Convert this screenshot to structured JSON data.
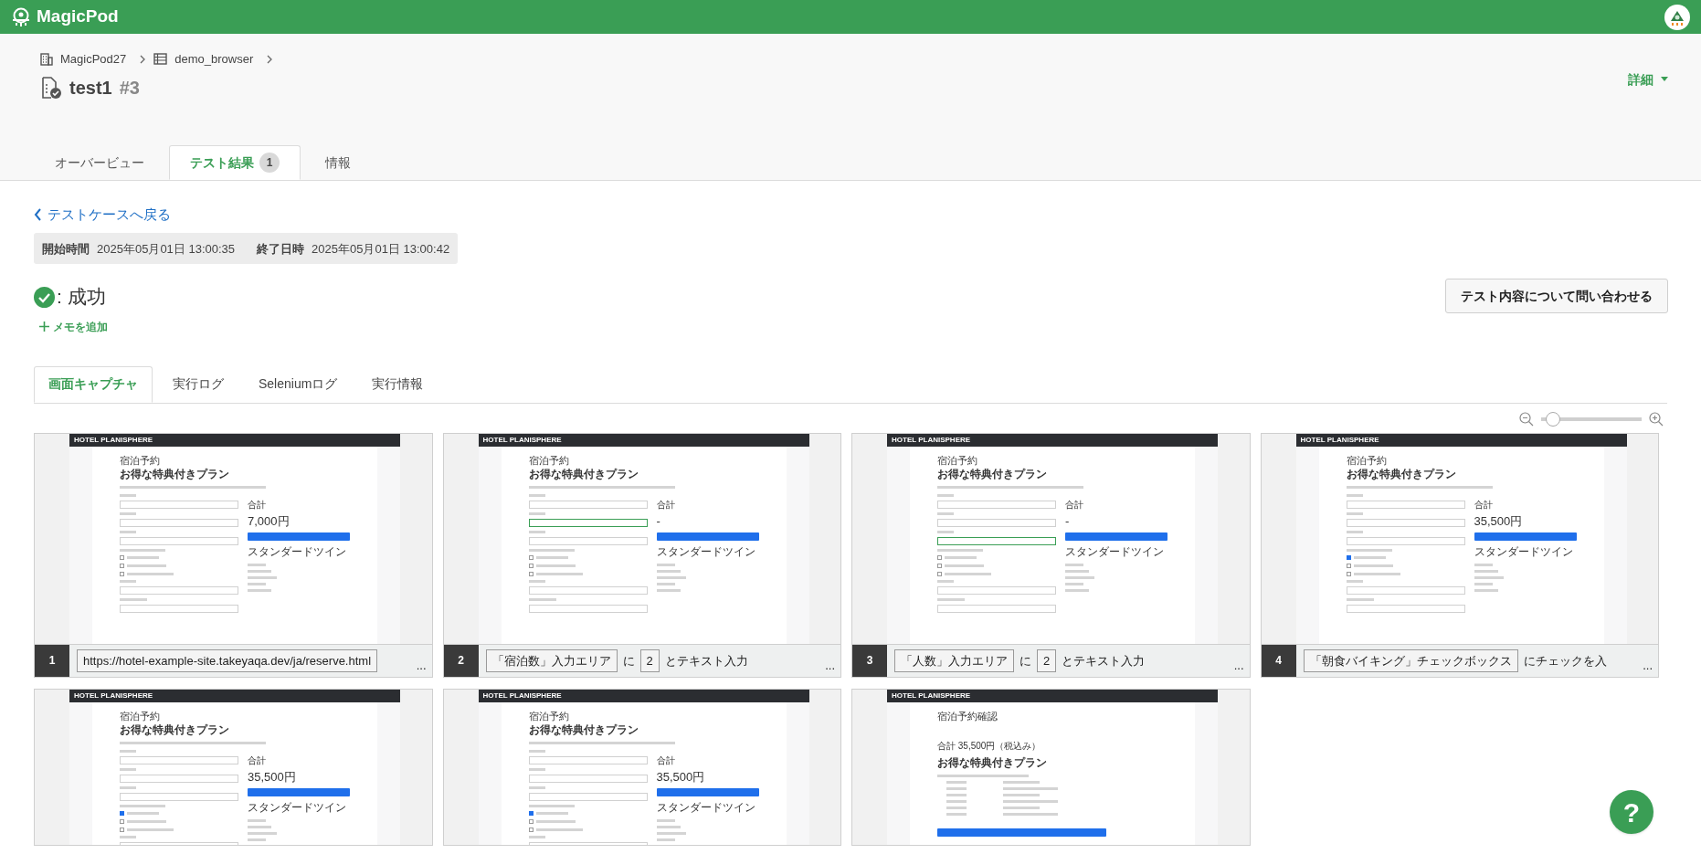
{
  "app": {
    "brand": "MagicPod"
  },
  "breadcrumb": [
    {
      "kind": "org",
      "label": "MagicPod27"
    },
    {
      "kind": "project",
      "label": "demo_browser"
    }
  ],
  "title": {
    "name": "test1",
    "number": "#3"
  },
  "details_menu": {
    "label": "詳細"
  },
  "tabs": [
    {
      "label": "オーバービュー",
      "selected": false
    },
    {
      "label": "テスト結果",
      "badge": "1",
      "selected": true
    },
    {
      "label": "情報",
      "selected": false
    }
  ],
  "back_link": "テストケースへ戻る",
  "times": [
    {
      "label": "開始時間",
      "value": "2025年05月01日 13:00:35"
    },
    {
      "label": "終了日時",
      "value": "2025年05月01日 13:00:42"
    }
  ],
  "result": {
    "kind": "success",
    "label": ": 成功"
  },
  "add_memo": "メモを追加",
  "contact_button": "テスト内容について問い合わせる",
  "sub_tabs": [
    {
      "label": "画面キャプチャ",
      "selected": true
    },
    {
      "label": "実行ログ",
      "selected": false
    },
    {
      "label": "Seleniumログ",
      "selected": false
    },
    {
      "label": "実行情報",
      "selected": false
    }
  ],
  "zoom": {
    "level": 0.12
  },
  "captures": [
    {
      "number": "1",
      "thumb": {
        "kind": "form",
        "header": "HOTEL PLANISPHERE",
        "title": "宿泊予約",
        "plan": "お得な特典付きプラン",
        "total_label": "合計",
        "total": "7,000円",
        "room": "スタンダードツイン",
        "nights_focused": false,
        "people_focused": false,
        "options": [
          {
            "checked": false
          },
          {
            "checked": false
          },
          {
            "checked": false
          }
        ]
      },
      "caption": [
        {
          "kind": "chip",
          "text": "https://hotel-example-site.takeyaqa.dev/ja/reserve.html"
        }
      ],
      "more": "..."
    },
    {
      "number": "2",
      "thumb": {
        "kind": "form",
        "header": "HOTEL PLANISPHERE",
        "title": "宿泊予約",
        "plan": "お得な特典付きプラン",
        "total_label": "合計",
        "total": "-",
        "room": "スタンダードツイン",
        "nights_focused": true,
        "people_focused": false,
        "options": [
          {
            "checked": false
          },
          {
            "checked": false
          },
          {
            "checked": false
          }
        ]
      },
      "caption": [
        {
          "kind": "chip",
          "text": "「宿泊数」入力エリア"
        },
        {
          "kind": "text",
          "text": "に"
        },
        {
          "kind": "chip",
          "text": "2"
        },
        {
          "kind": "text",
          "text": "とテキスト入力"
        }
      ],
      "more": "..."
    },
    {
      "number": "3",
      "thumb": {
        "kind": "form",
        "header": "HOTEL PLANISPHERE",
        "title": "宿泊予約",
        "plan": "お得な特典付きプラン",
        "total_label": "合計",
        "total": "-",
        "room": "スタンダードツイン",
        "nights_focused": false,
        "people_focused": true,
        "options": [
          {
            "checked": false
          },
          {
            "checked": false
          },
          {
            "checked": false
          }
        ]
      },
      "caption": [
        {
          "kind": "chip",
          "text": "「人数」入力エリア"
        },
        {
          "kind": "text",
          "text": "に"
        },
        {
          "kind": "chip",
          "text": "2"
        },
        {
          "kind": "text",
          "text": "とテキスト入力"
        }
      ],
      "more": "..."
    },
    {
      "number": "4",
      "thumb": {
        "kind": "form",
        "header": "HOTEL PLANISPHERE",
        "title": "宿泊予約",
        "plan": "お得な特典付きプラン",
        "total_label": "合計",
        "total": "35,500円",
        "room": "スタンダードツイン",
        "nights_focused": false,
        "people_focused": false,
        "options": [
          {
            "checked": true
          },
          {
            "checked": false
          },
          {
            "checked": false
          }
        ]
      },
      "caption": [
        {
          "kind": "chip",
          "text": "「朝食バイキング」チェックボックス"
        },
        {
          "kind": "text",
          "text": "にチェックを入"
        }
      ],
      "more": "..."
    },
    {
      "thumb": {
        "kind": "form",
        "header": "HOTEL PLANISPHERE",
        "title": "宿泊予約",
        "plan": "お得な特典付きプラン",
        "total_label": "合計",
        "total": "35,500円",
        "room": "スタンダードツイン",
        "nights_focused": false,
        "people_focused": false,
        "options": [
          {
            "checked": true
          },
          {
            "checked": false
          },
          {
            "checked": false
          }
        ]
      }
    },
    {
      "thumb": {
        "kind": "form",
        "header": "HOTEL PLANISPHERE",
        "title": "宿泊予約",
        "plan": "お得な特典付きプラン",
        "total_label": "合計",
        "total": "35,500円",
        "room": "スタンダードツイン",
        "nights_focused": false,
        "people_focused": false,
        "options": [
          {
            "checked": true
          },
          {
            "checked": false
          },
          {
            "checked": false
          }
        ]
      }
    },
    {
      "thumb": {
        "kind": "confirm",
        "header": "HOTEL PLANISPHERE",
        "title": "宿泊予約確認",
        "total": "合計 35,500円（税込み）",
        "plan": "お得な特典付きプラン"
      }
    }
  ],
  "help_button": "?"
}
